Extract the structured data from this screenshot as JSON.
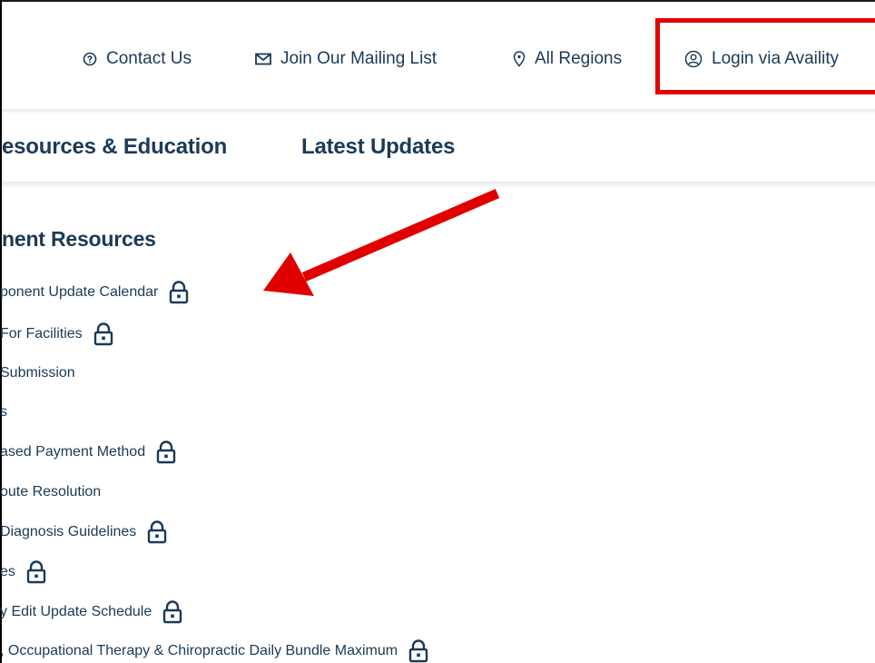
{
  "utility_bar": {
    "contact_us": "Contact Us",
    "mailing_list": "Join Our Mailing List",
    "regions": "All Regions",
    "login": "Login via Availity"
  },
  "main_nav": {
    "items": [
      {
        "label": "esources & Education"
      },
      {
        "label": "Latest Updates"
      }
    ]
  },
  "section": {
    "title": "nent Resources"
  },
  "resources": [
    {
      "label": "ponent Update Calendar",
      "locked": true
    },
    {
      "label": "For Facilities",
      "locked": true
    },
    {
      "label": "Submission",
      "locked": false
    },
    {
      "label": "s",
      "locked": false
    },
    {
      "label": "ased Payment Method",
      "locked": true
    },
    {
      "label": "oute Resolution",
      "locked": false
    },
    {
      "label": "Diagnosis Guidelines",
      "locked": true
    },
    {
      "label": "es",
      "locked": true
    },
    {
      "label": "y Edit Update Schedule",
      "locked": true
    },
    {
      "label": ", Occupational Therapy & Chiropractic Daily Bundle Maximum",
      "locked": true
    }
  ],
  "colors": {
    "text": "#1b3a57",
    "highlight": "#e00000",
    "arrow": "#e00000"
  },
  "icons": {
    "contact": "question-circle-icon",
    "mail": "envelope-icon",
    "region": "map-pin-icon",
    "login": "user-circle-icon",
    "lock": "lock-icon"
  }
}
